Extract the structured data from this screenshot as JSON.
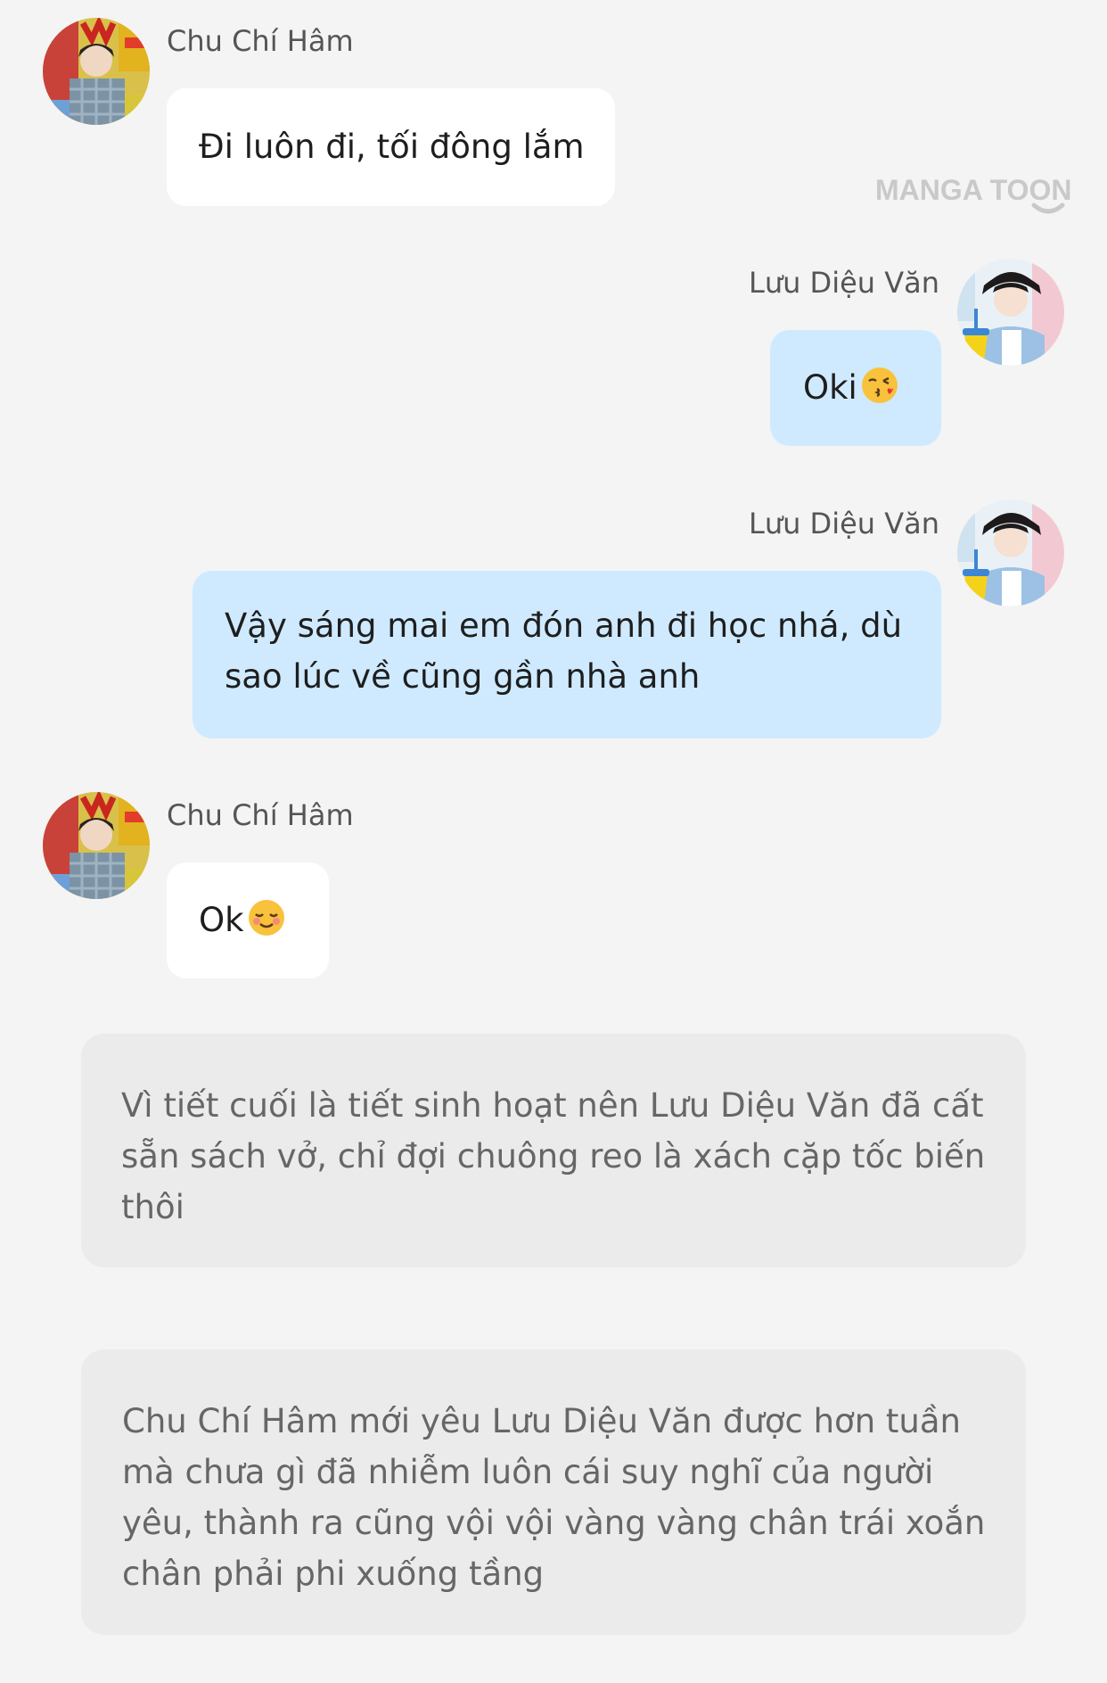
{
  "watermark": {
    "text": "MANGA TOON"
  },
  "messages": [
    {
      "side": "left",
      "sender": "Chu Chí Hâm",
      "avatar": "boy-yellow-poster-avatar",
      "text": "Đi luôn đi, tối đông lắm"
    },
    {
      "side": "right",
      "sender": "Lưu Diệu Văn",
      "avatar": "boy-blue-shirt-avatar",
      "text": "Oki",
      "emoji": "kissing-heart-emoji"
    },
    {
      "side": "right",
      "sender": "Lưu Diệu Văn",
      "avatar": "boy-blue-shirt-avatar",
      "lines": [
        "Vậy sáng mai em đón anh đi học nhá, dù",
        "sao lúc về cũng gần nhà anh"
      ]
    },
    {
      "side": "left",
      "sender": "Chu Chí Hâm",
      "avatar": "boy-yellow-poster-avatar",
      "text": "Ok",
      "emoji": "smiling-blush-emoji"
    }
  ],
  "narrations": [
    {
      "lines": [
        "Vì tiết cuối là tiết sinh hoạt nên Lưu Diệu Văn đã cất",
        "sẵn sách vở, chỉ đợi chuông reo là xách cặp tốc biến",
        "thôi"
      ]
    },
    {
      "lines": [
        "Chu Chí Hâm mới yêu Lưu Diệu Văn được hơn tuần",
        "mà chưa gì đã nhiễm luôn cái suy nghĩ của người",
        "yêu, thành ra cũng vội vội vàng vàng chân trái xoắn",
        "chân phải phi xuống tầng"
      ]
    }
  ],
  "colors": {
    "background": "#f4f4f4",
    "left_bubble": "#ffffff",
    "right_bubble": "#cfeafe",
    "narration_box": "#ebebeb",
    "watermark": "#c9c9c9"
  }
}
